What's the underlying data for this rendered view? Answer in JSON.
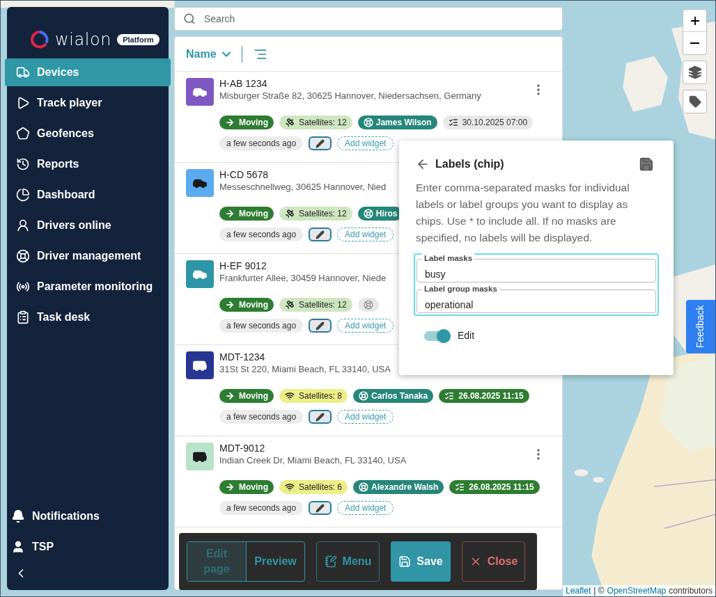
{
  "logo": {
    "wordmark": "wialon",
    "badge": "Platform"
  },
  "sidebar": {
    "items": [
      {
        "label": "Devices",
        "selected": true
      },
      {
        "label": "Track player",
        "selected": false
      },
      {
        "label": "Geofences",
        "selected": false
      },
      {
        "label": "Reports",
        "selected": false
      },
      {
        "label": "Dashboard",
        "selected": false
      },
      {
        "label": "Drivers online",
        "selected": false
      },
      {
        "label": "Driver management",
        "selected": false
      },
      {
        "label": "Parameter monitoring",
        "selected": false
      },
      {
        "label": "Task desk",
        "selected": false
      }
    ],
    "bottom_items": [
      {
        "label": "Notifications"
      },
      {
        "label": "TSP"
      }
    ]
  },
  "search": {
    "placeholder": "Search"
  },
  "list": {
    "sort_label": "Name",
    "devices": [
      {
        "name": "H-AB 1234",
        "address": "Misburger Straße 82, 30625 Hannover, Niedersachsen, Germany",
        "kind": "car",
        "color": "#7e57c2",
        "menu": true,
        "chips": [
          {
            "kind": "status",
            "text": "Moving"
          },
          {
            "kind": "satellites",
            "text": "Satellites: 12"
          },
          {
            "kind": "driver",
            "text": "James Wilson"
          },
          {
            "kind": "date",
            "text": "30.10.2025 07:00",
            "color": "#e8e8e8"
          }
        ],
        "time": "a few seconds ago",
        "add": "Add widget"
      },
      {
        "name": "H-CD 5678",
        "address": "Messeschnellweg, 30625 Hannover, Nied",
        "kind": "car",
        "color": "#5aabf0",
        "menu": false,
        "chips": [
          {
            "kind": "status",
            "text": "Moving"
          },
          {
            "kind": "satellites",
            "text": "Satellites: 12"
          },
          {
            "kind": "driver",
            "text": "Hiros"
          }
        ],
        "time": "a few seconds ago",
        "add": "Add widget"
      },
      {
        "name": "H-EF 9012",
        "address": "Frankfurter Allee, 30459 Hannover, Niede",
        "kind": "car",
        "color": "#2e96a6",
        "menu": false,
        "chips": [
          {
            "kind": "status",
            "text": "Moving"
          },
          {
            "kind": "satellites",
            "text": "Satellites: 12"
          },
          {
            "kind": "nodriver"
          }
        ],
        "time": "a few seconds ago",
        "add": "Add widget"
      },
      {
        "name": "MDT-1234",
        "address": "31St St 220, Miami Beach, FL 33140, USA",
        "kind": "bus",
        "color": "#283593",
        "menu": false,
        "chips": [
          {
            "kind": "status",
            "text": "Moving"
          },
          {
            "kind": "signal",
            "text": "Satellites: 8"
          },
          {
            "kind": "driver",
            "text": "Carlos Tanaka"
          },
          {
            "kind": "date",
            "text": "26.08.2025 11:15",
            "color": "#2e7d32"
          }
        ],
        "time": "a few seconds ago",
        "add": "Add widget"
      },
      {
        "name": "MDT-9012",
        "address": "Indian Creek Dr, Miami Beach, FL 33140, USA",
        "kind": "bus",
        "color": "#b9e2cb",
        "menu": true,
        "chips": [
          {
            "kind": "status",
            "text": "Moving"
          },
          {
            "kind": "signal",
            "text": "Satellites: 6"
          },
          {
            "kind": "driver",
            "text": "Alexandre Walsh"
          },
          {
            "kind": "date",
            "text": "26.08.2025 11:15",
            "color": "#2e7d32"
          }
        ],
        "time": "a few seconds ago",
        "add": "Add widget"
      }
    ]
  },
  "popup": {
    "title": "Labels (chip)",
    "description": "Enter comma-separated masks for individual labels or label groups you want to display as chips. Use * to include all. If no masks are specified, no labels will be displayed.",
    "fields": [
      {
        "label": "Label masks",
        "value": "busy"
      },
      {
        "label": "Label group masks",
        "value": "operational"
      }
    ],
    "toggle": {
      "label": "Edit",
      "on": true
    }
  },
  "toolbar": {
    "segments": [
      {
        "label": "Edit page",
        "selected": true
      },
      {
        "label": "Preview",
        "selected": false
      }
    ],
    "buttons": [
      {
        "kind": "menu",
        "label": "Menu"
      },
      {
        "kind": "save",
        "label": "Save"
      },
      {
        "kind": "close",
        "label": "Close"
      }
    ]
  },
  "map": {
    "feedback": "Feedback",
    "leaflet": "Leaflet",
    "separator": "| ©",
    "osm": "OpenStreetMap",
    "contributors": "contributors"
  }
}
